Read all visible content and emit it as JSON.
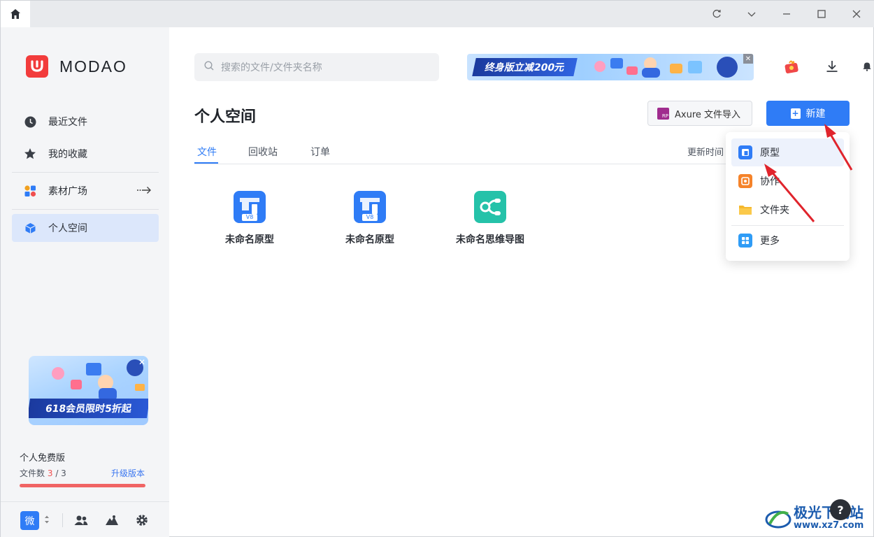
{
  "window": {
    "controls": [
      "refresh-icon",
      "chevron-down-icon",
      "minimize-icon",
      "maximize-icon",
      "close-icon"
    ]
  },
  "sidebar": {
    "logo_text": "MODAO",
    "items": [
      {
        "label": "最近文件",
        "icon": "clock-icon"
      },
      {
        "label": "我的收藏",
        "icon": "star-icon"
      },
      {
        "label": "素材广场",
        "icon": "shapes-icon"
      },
      {
        "label": "个人空间",
        "icon": "cube-icon"
      }
    ],
    "promo_text": "618会员限时5折起",
    "plan_name": "个人免费版",
    "files_label": "文件数",
    "files_used": "3",
    "files_total": "/ 3",
    "upgrade_label": "升级版本",
    "quota_fraction": 1.0,
    "user_badge": "微"
  },
  "header": {
    "search_placeholder": "搜索的文件/文件夹名称",
    "banner_text": "终身版立减200元"
  },
  "main": {
    "title": "个人空间",
    "axure_badge": "RP",
    "axure_button": "Axure 文件导入",
    "new_button": "新建",
    "tabs": [
      "文件",
      "回收站",
      "订单"
    ],
    "sort_label": "更新时间",
    "files": [
      {
        "name": "未命名原型",
        "type": "prototype",
        "badge": "V8"
      },
      {
        "name": "未命名原型",
        "type": "prototype",
        "badge": "V8"
      },
      {
        "name": "未命名思维导图",
        "type": "mindmap"
      }
    ]
  },
  "dropdown": {
    "items": [
      {
        "label": "原型",
        "icon": "prototype-icon"
      },
      {
        "label": "协作",
        "icon": "collab-icon"
      },
      {
        "label": "文件夹",
        "icon": "folder-icon"
      },
      {
        "label": "更多",
        "icon": "grid-icon"
      }
    ]
  },
  "watermark": {
    "line1": "极光下载站",
    "line2": "www.xz7.com"
  },
  "colors": {
    "accent": "#2f7cf6",
    "brand_red": "#f23c3c",
    "arrow_red": "#e0242c"
  }
}
